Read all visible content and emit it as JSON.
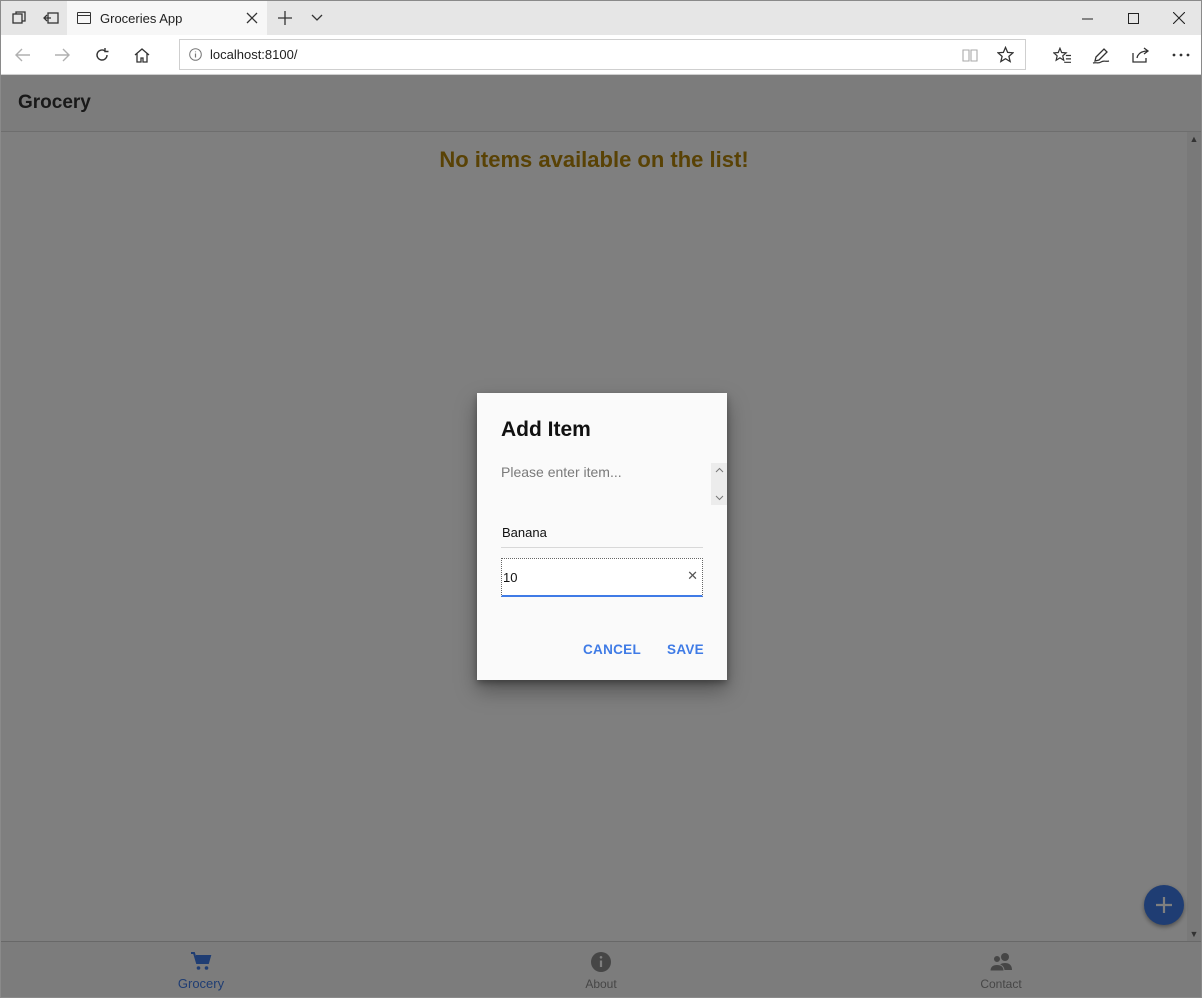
{
  "browser": {
    "tab_title": "Groceries App",
    "url": "localhost:8100/"
  },
  "app": {
    "header_title": "Grocery",
    "empty_message": "No items available on the list!",
    "tabs": [
      {
        "label": "Grocery",
        "icon": "cart-icon",
        "active": true
      },
      {
        "label": "About",
        "icon": "info-icon",
        "active": false
      },
      {
        "label": "Contact",
        "icon": "people-icon",
        "active": false
      }
    ]
  },
  "dialog": {
    "title": "Add Item",
    "message": "Please enter item...",
    "name_value": "Banana",
    "quantity_value": "10",
    "cancel_label": "CANCEL",
    "save_label": "SAVE"
  },
  "colors": {
    "accent": "#3f7be6",
    "empty_message": "#b3840b",
    "backdrop": "rgba(0,0,0,0.5)"
  }
}
